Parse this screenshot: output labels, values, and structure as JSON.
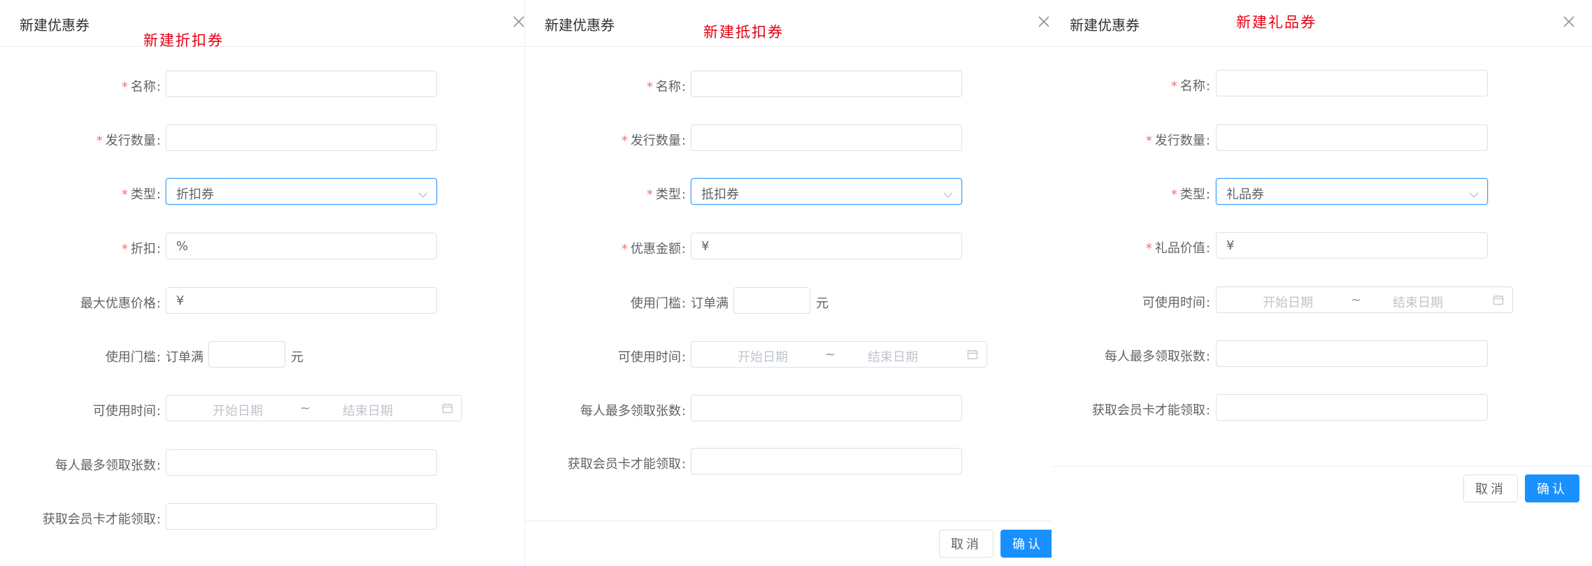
{
  "colors": {
    "required": "#f56c6c",
    "primary": "#1890ff",
    "focus_border": "#409eff",
    "annotation": "#e60012"
  },
  "icons": {
    "close": "close-icon",
    "dropdown": "chevron-down-icon",
    "calendar": "calendar-icon"
  },
  "dialog1": {
    "title": "新建优惠券",
    "annotation": "新建折扣券",
    "labels": {
      "name": "名称",
      "quantity": "发行数量",
      "type": "类型",
      "discount": "折扣",
      "max_price": "最大优惠价格",
      "threshold": "使用门槛",
      "time": "可使用时间",
      "per_user": "每人最多领取张数",
      "member": "获取会员卡才能领取"
    },
    "type_value": "折扣券",
    "discount_prefix": "%",
    "max_price_prefix": "¥",
    "threshold_prefix": "订单满",
    "threshold_suffix": "元",
    "start_placeholder": "开始日期",
    "range_sep": "~",
    "end_placeholder": "结束日期"
  },
  "dialog2": {
    "title": "新建优惠券",
    "annotation": "新建抵扣券",
    "labels": {
      "name": "名称",
      "quantity": "发行数量",
      "type": "类型",
      "amount": "优惠金额",
      "threshold": "使用门槛",
      "time": "可使用时间",
      "per_user": "每人最多领取张数",
      "member": "获取会员卡才能领取"
    },
    "type_value": "抵扣券",
    "amount_prefix": "¥",
    "threshold_prefix": "订单满",
    "threshold_suffix": "元",
    "start_placeholder": "开始日期",
    "range_sep": "~",
    "end_placeholder": "结束日期",
    "cancel": "取消",
    "confirm": "确认"
  },
  "dialog3": {
    "title": "新建优惠券",
    "annotation": "新建礼品券",
    "labels": {
      "name": "名称",
      "quantity": "发行数量",
      "type": "类型",
      "gift_value": "礼品价值",
      "time": "可使用时间",
      "per_user": "每人最多领取张数",
      "member": "获取会员卡才能领取"
    },
    "type_value": "礼品券",
    "gift_prefix": "¥",
    "start_placeholder": "开始日期",
    "range_sep": "~",
    "end_placeholder": "结束日期",
    "cancel": "取消",
    "confirm": "确认"
  }
}
